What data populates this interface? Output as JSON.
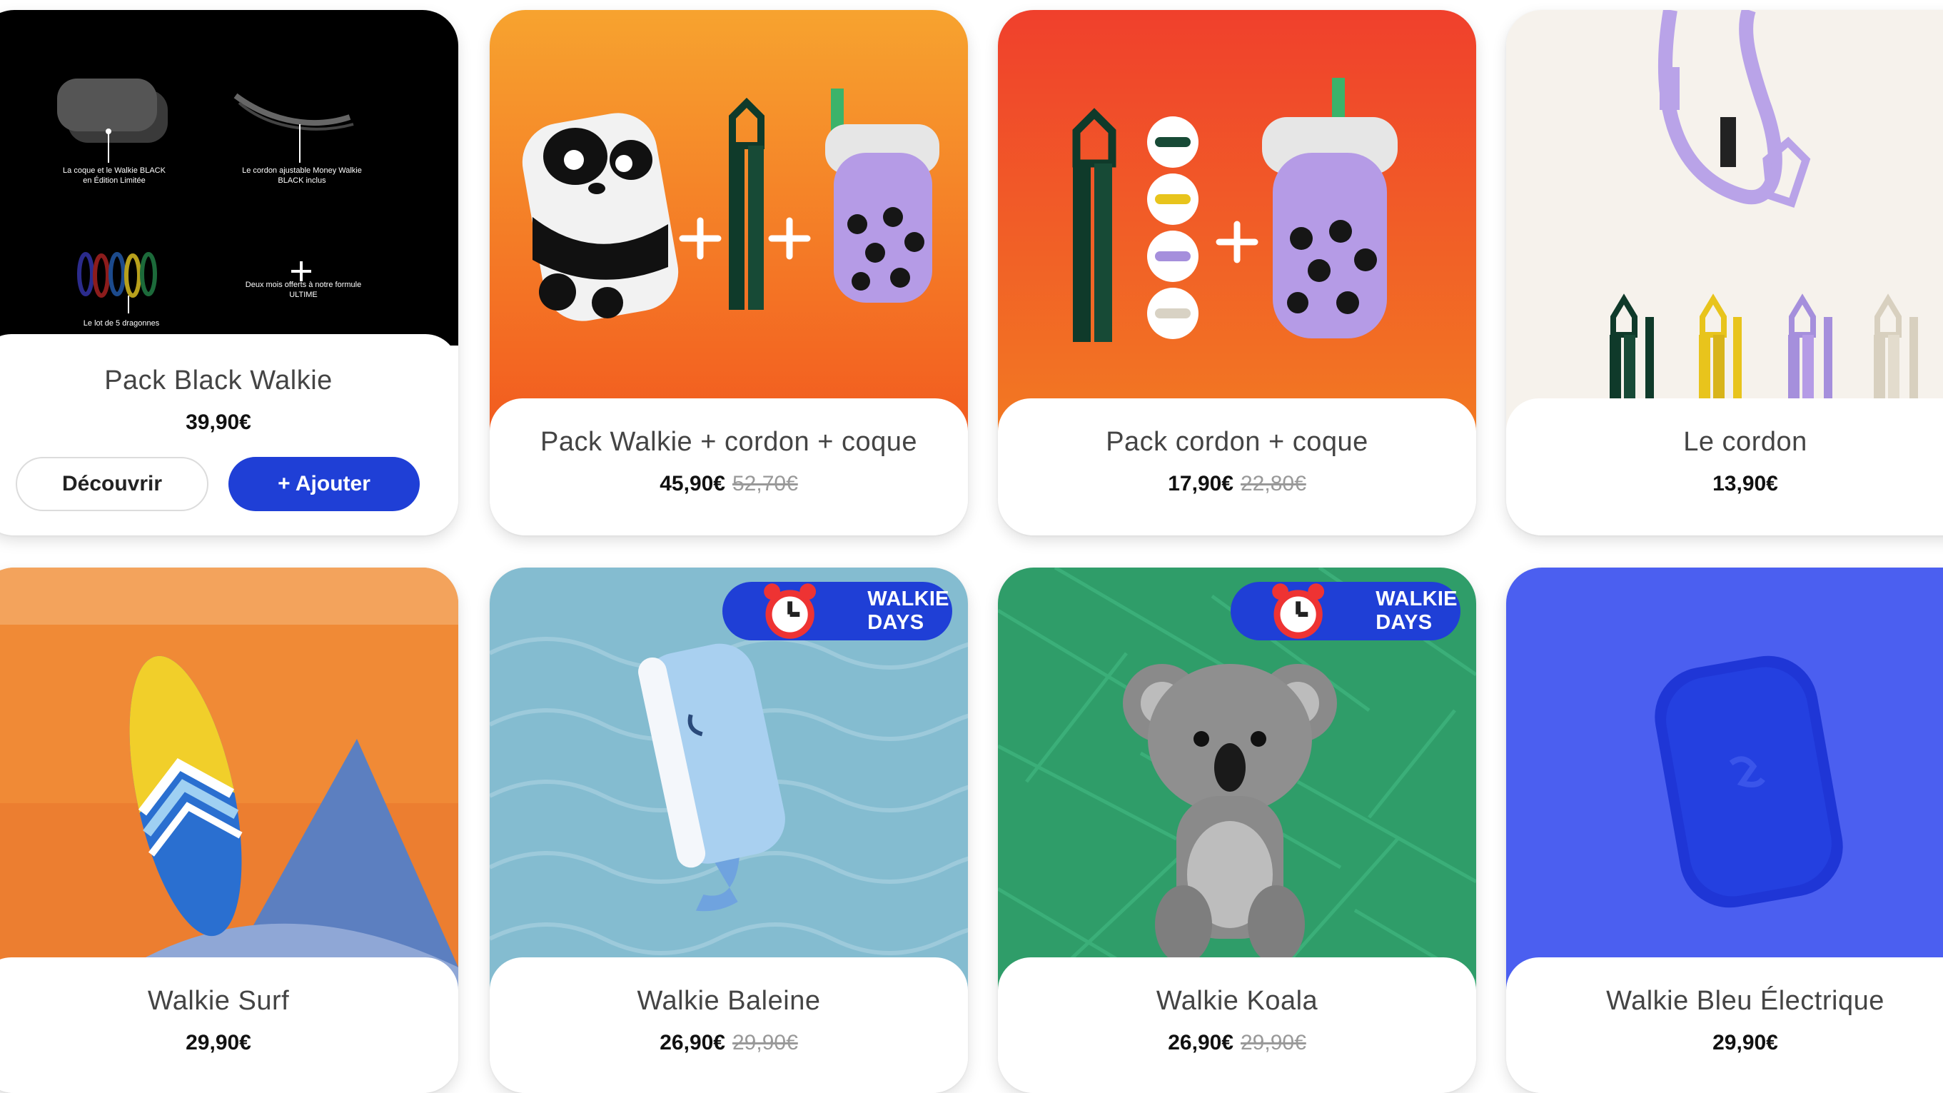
{
  "badge_label": "WALKIE DAYS",
  "colors": {
    "accent": "#1f3fd6",
    "orange": "#f28c28",
    "red": "#f03a2a",
    "cream": "#f6f2ec",
    "blue_wave": "#84bcd0",
    "green_leaf": "#2f9d69",
    "electric_blue": "#4b5ff0"
  },
  "products": [
    {
      "title": "Pack Black Walkie",
      "price": "39,90€",
      "old_price": "",
      "buttons": {
        "discover": "Découvrir",
        "add": "+ Ajouter"
      },
      "captions": {
        "case": "La coque et le Walkie BLACK en Édition Limitée",
        "cord": "Le cordon ajustable Money Walkie BLACK inclus",
        "straps": "Le lot de 5 dragonnes",
        "months": "Deux mois offerts à notre formule ULTIME"
      }
    },
    {
      "title": "Pack Walkie + cordon + coque",
      "price": "45,90€",
      "old_price": "52,70€"
    },
    {
      "title": "Pack cordon + coque",
      "price": "17,90€",
      "old_price": "22,80€"
    },
    {
      "title": "Le cordon",
      "price": "13,90€",
      "old_price": ""
    },
    {
      "title": "Walkie Surf",
      "price": "29,90€",
      "old_price": ""
    },
    {
      "title": "Walkie Baleine",
      "price": "26,90€",
      "old_price": "29,90€",
      "badge": "WALKIE DAYS"
    },
    {
      "title": "Walkie Koala",
      "price": "26,90€",
      "old_price": "29,90€",
      "badge": "WALKIE DAYS"
    },
    {
      "title": "Walkie Bleu Électrique",
      "price": "29,90€",
      "old_price": ""
    }
  ]
}
